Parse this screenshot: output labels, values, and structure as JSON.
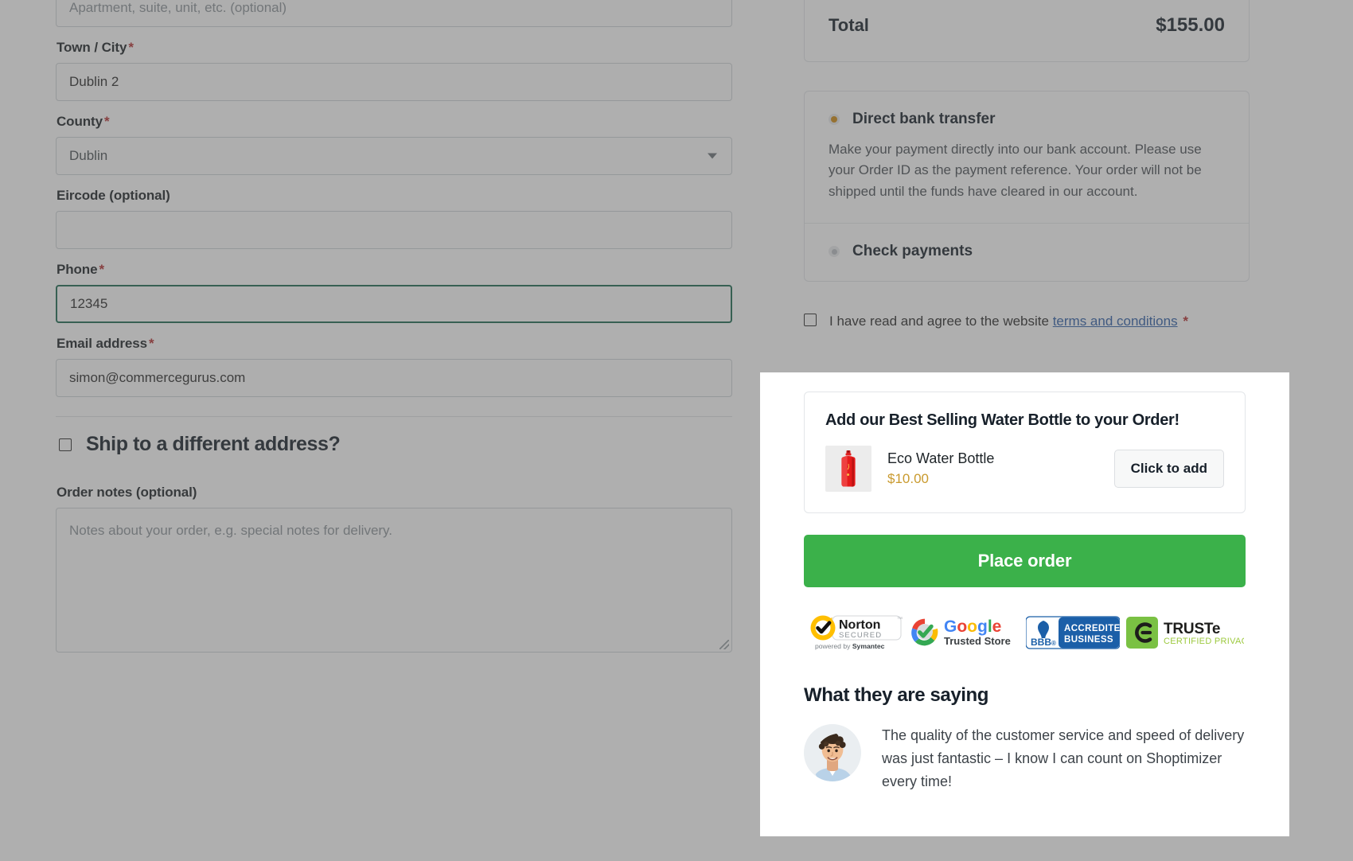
{
  "colors": {
    "overlay_gray": "#919191",
    "place_order_green": "#3bb14a",
    "price_gold": "#c99a2e",
    "link_blue": "#2f5fa8",
    "required_red": "#b32d2e",
    "focus_green": "#1d6b52"
  },
  "checkout": {
    "fields": {
      "apartment": {
        "label": "",
        "placeholder": "Apartment, suite, unit, etc. (optional)",
        "value": ""
      },
      "town_city": {
        "label": "Town / City",
        "required_mark": "*",
        "value": "Dublin 2"
      },
      "county": {
        "label": "County",
        "required_mark": "*",
        "value": "Dublin"
      },
      "eircode": {
        "label": "Eircode (optional)",
        "value": ""
      },
      "phone": {
        "label": "Phone",
        "required_mark": "*",
        "value": "12345"
      },
      "email": {
        "label": "Email address",
        "required_mark": "*",
        "value": "simon@commercegurus.com"
      },
      "ship_different": {
        "label": "Ship to a different address?",
        "checked": false
      },
      "order_notes": {
        "label": "Order notes (optional)",
        "placeholder": "Notes about your order, e.g. special notes for delivery.",
        "value": ""
      }
    },
    "order_summary": {
      "total_label": "Total",
      "total_value": "$155.00"
    },
    "payment_methods": [
      {
        "name": "Direct bank transfer",
        "selected": true,
        "description": "Make your payment directly into our bank account. Please use your Order ID as the payment reference. Your order will not be shipped until the funds have cleared in our account."
      },
      {
        "name": "Check payments",
        "selected": false,
        "description": ""
      }
    ],
    "terms": {
      "prefix": "I have read and agree to the website ",
      "link_text": "terms and conditions",
      "required_mark": "*",
      "checked": false
    }
  },
  "modal": {
    "upsell": {
      "title": "Add our Best Selling Water Bottle to your Order!",
      "product_name": "Eco Water Bottle",
      "product_price": "$10.00",
      "product_image_alt": "red eco water bottle",
      "add_button": "Click to add"
    },
    "place_order_button": "Place order",
    "trust_badges": [
      {
        "id": "norton-secured",
        "line1": "Norton",
        "line2": "SECURED",
        "line3": "powered by Symantec"
      },
      {
        "id": "google-trusted-store",
        "line1": "Google",
        "line2": "Trusted Store"
      },
      {
        "id": "bbb-accredited-business",
        "line1": "BBB",
        "line2": "ACCREDITED",
        "line3": "BUSINESS"
      },
      {
        "id": "truste-certified-privacy",
        "line1": "TRUSTe",
        "line2": "CERTIFIED PRIVACY"
      }
    ],
    "testimonials_heading": "What they are saying",
    "testimonial": {
      "quote": "The quality of the customer service and speed of delivery was just fantastic – I know I can count on Shoptimizer every time!",
      "avatar_alt": "smiling young man with curly hair"
    }
  }
}
